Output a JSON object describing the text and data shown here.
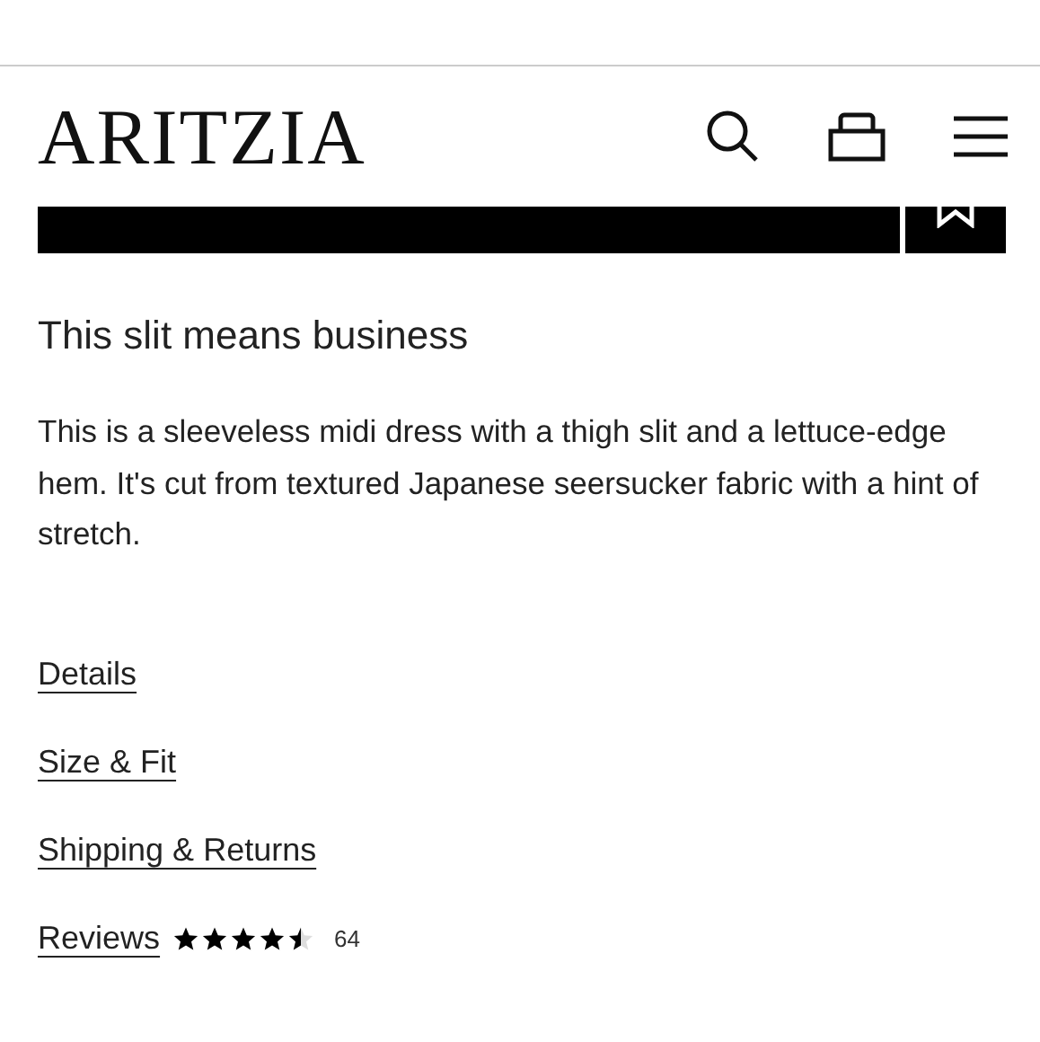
{
  "header": {
    "logo": "ARITZIA"
  },
  "product": {
    "title": "This slit means business",
    "description": "This is a sleeveless midi dress with a thigh slit and a lettuce-edge hem. It's cut from textured Japanese seersucker fabric with a hint of stretch."
  },
  "sections": [
    {
      "label": "Details",
      "kind": "link"
    },
    {
      "label": "Size & Fit",
      "kind": "link"
    },
    {
      "label": "Shipping & Returns",
      "kind": "link"
    },
    {
      "label": "Reviews",
      "kind": "reviews",
      "stars": 4.5,
      "count": "64"
    }
  ]
}
